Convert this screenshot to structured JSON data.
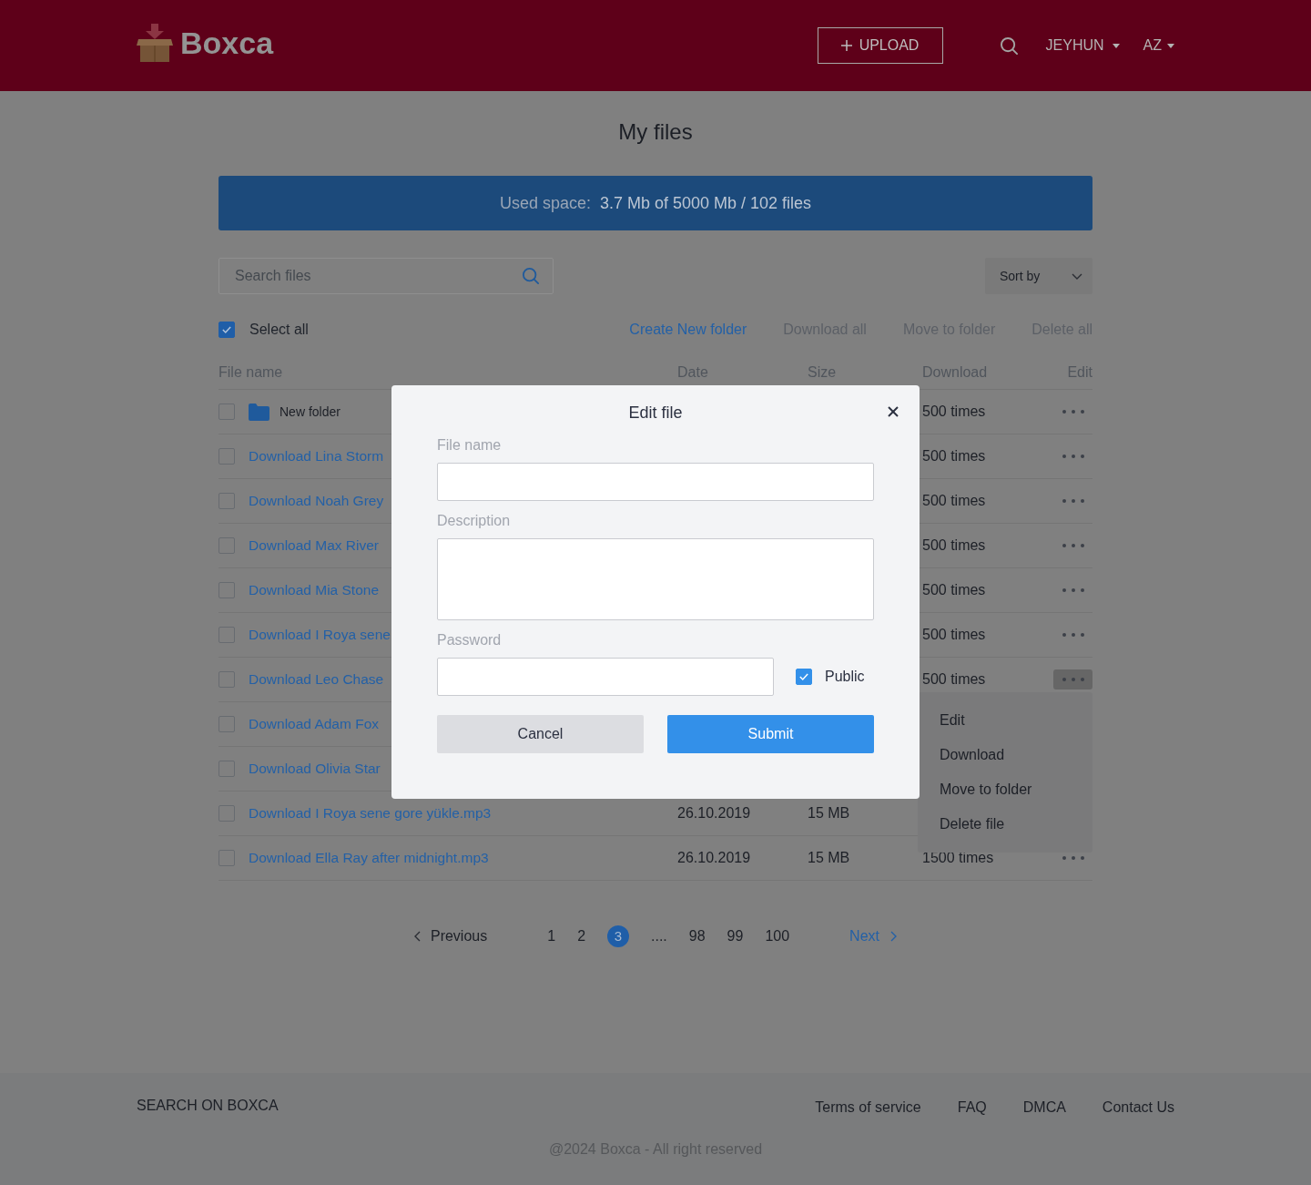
{
  "header": {
    "logo": "Boxca",
    "upload_button": "UPLOAD",
    "user_menu": "JEYHUN",
    "language_menu": "AZ"
  },
  "page": {
    "title": "My files"
  },
  "usage_bar": {
    "label": "Used space:",
    "value": "3.7 Mb of 5000 Mb / 102 files"
  },
  "toolbar": {
    "search": {
      "placeholder": "Search files"
    },
    "sort": {
      "label": "Sort by"
    }
  },
  "bulk_actions": {
    "select_all": {
      "label": "Select all",
      "checked": true
    },
    "actions": [
      {
        "label": "Create New folder",
        "disabled": false
      },
      {
        "label": "Download all",
        "disabled": true
      },
      {
        "label": "Move to folder",
        "disabled": true
      },
      {
        "label": "Delete all",
        "disabled": true
      }
    ]
  },
  "table": {
    "columns": [
      "File name",
      "Date",
      "Size",
      "Download",
      "Edit"
    ],
    "rows": [
      {
        "kind": "folder",
        "name": "New folder",
        "checked": false,
        "downloads": "500 times",
        "menu_open": false
      },
      {
        "kind": "file",
        "name": "Download Lina Storm",
        "checked": false,
        "downloads": "500 times",
        "menu_open": false
      },
      {
        "kind": "file",
        "name": "Download Noah Grey",
        "checked": false,
        "downloads": "500 times",
        "menu_open": false
      },
      {
        "kind": "file",
        "name": "Download Max River",
        "checked": false,
        "downloads": "500 times",
        "menu_open": false
      },
      {
        "kind": "file",
        "name": "Download Mia Stone",
        "checked": false,
        "downloads": "500 times",
        "menu_open": false
      },
      {
        "kind": "file",
        "name": "Download I Roya sene",
        "checked": false,
        "downloads": "500 times",
        "menu_open": false
      },
      {
        "kind": "file",
        "name": "Download Leo Chase",
        "checked": false,
        "downloads": "500 times",
        "menu_open": true,
        "menu": [
          "Edit",
          "Download",
          "Move to folder",
          "Delete file"
        ]
      },
      {
        "kind": "file",
        "name": "Download Adam Fox",
        "checked": false
      },
      {
        "kind": "file",
        "name": "Download Olivia Star",
        "checked": false
      },
      {
        "kind": "file",
        "name": "Download I Roya sene gore yükle.mp3",
        "checked": false,
        "date": "26.10.2019",
        "size": "15 MB"
      },
      {
        "kind": "file",
        "name": "Download Ella Ray after midnight.mp3",
        "checked": false,
        "date": "26.10.2019",
        "size": "15 MB",
        "downloads": "1500 times",
        "menu_open": false
      }
    ]
  },
  "pagination": {
    "previous": "Previous",
    "pages": [
      {
        "kind": "page",
        "label": "1",
        "selected": false
      },
      {
        "kind": "page",
        "label": "2",
        "selected": false
      },
      {
        "kind": "page",
        "label": "3",
        "selected": true
      },
      {
        "kind": "gap",
        "label": "...."
      },
      {
        "kind": "page",
        "label": "98",
        "selected": false
      },
      {
        "kind": "page",
        "label": "99",
        "selected": false
      },
      {
        "kind": "page",
        "label": "100",
        "selected": false
      }
    ],
    "next": "Next"
  },
  "footer": {
    "brand_link": "SEARCH ON BOXCA",
    "links": [
      "Terms of service",
      "FAQ",
      "DMCA",
      "Contact Us"
    ],
    "copyright": "@2024 Boxca - All right reserved"
  },
  "modal": {
    "title": "Edit file",
    "fields": [
      {
        "kind": "text",
        "label": "File name"
      },
      {
        "kind": "textarea",
        "label": "Description"
      },
      {
        "kind": "password",
        "label": "Password"
      }
    ],
    "public": {
      "label": "Public",
      "checked": true
    },
    "buttons": [
      {
        "kind": "secondary",
        "label": "Cancel"
      },
      {
        "kind": "primary",
        "label": "Submit"
      }
    ]
  }
}
